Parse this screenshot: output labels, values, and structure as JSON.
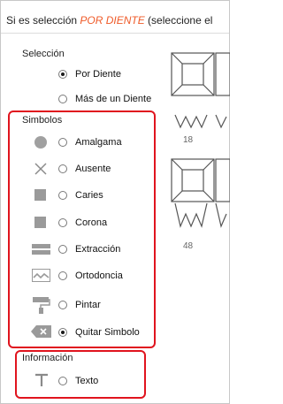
{
  "header": {
    "prefix": "Si es selección ",
    "highlight": "POR DIENTE",
    "suffix": " (seleccione el"
  },
  "seleccion": {
    "title": "Selección",
    "options": [
      {
        "label": "Por Diente",
        "checked": true
      },
      {
        "label": "Más de un Diente",
        "checked": false
      }
    ]
  },
  "simbolos": {
    "title": "Simbolos",
    "items": [
      {
        "label": "Amalgama",
        "icon": "amalgama-circle-icon",
        "checked": false
      },
      {
        "label": "Ausente",
        "icon": "ausente-x-icon",
        "checked": false
      },
      {
        "label": "Caries",
        "icon": "caries-square-icon",
        "checked": false
      },
      {
        "label": "Corona",
        "icon": "corona-square-icon",
        "checked": false
      },
      {
        "label": "Extracción",
        "icon": "extraccion-bars-icon",
        "checked": false
      },
      {
        "label": "Ortodoncia",
        "icon": "ortodoncia-wave-icon",
        "checked": false
      },
      {
        "label": "Pintar",
        "icon": "paint-roller-icon",
        "checked": false
      },
      {
        "label": "Quitar Simbolo",
        "icon": "eraser-icon",
        "checked": true
      }
    ]
  },
  "informacion": {
    "title": "Información",
    "items": [
      {
        "label": "Texto",
        "icon": "text-t-icon",
        "checked": false
      }
    ]
  },
  "teeth": [
    {
      "number": "18"
    },
    {
      "number": "48"
    }
  ],
  "colors": {
    "highlight": "#ef5a28",
    "red_annotation": "#e0141e",
    "icon_gray": "#a0a0a0"
  }
}
